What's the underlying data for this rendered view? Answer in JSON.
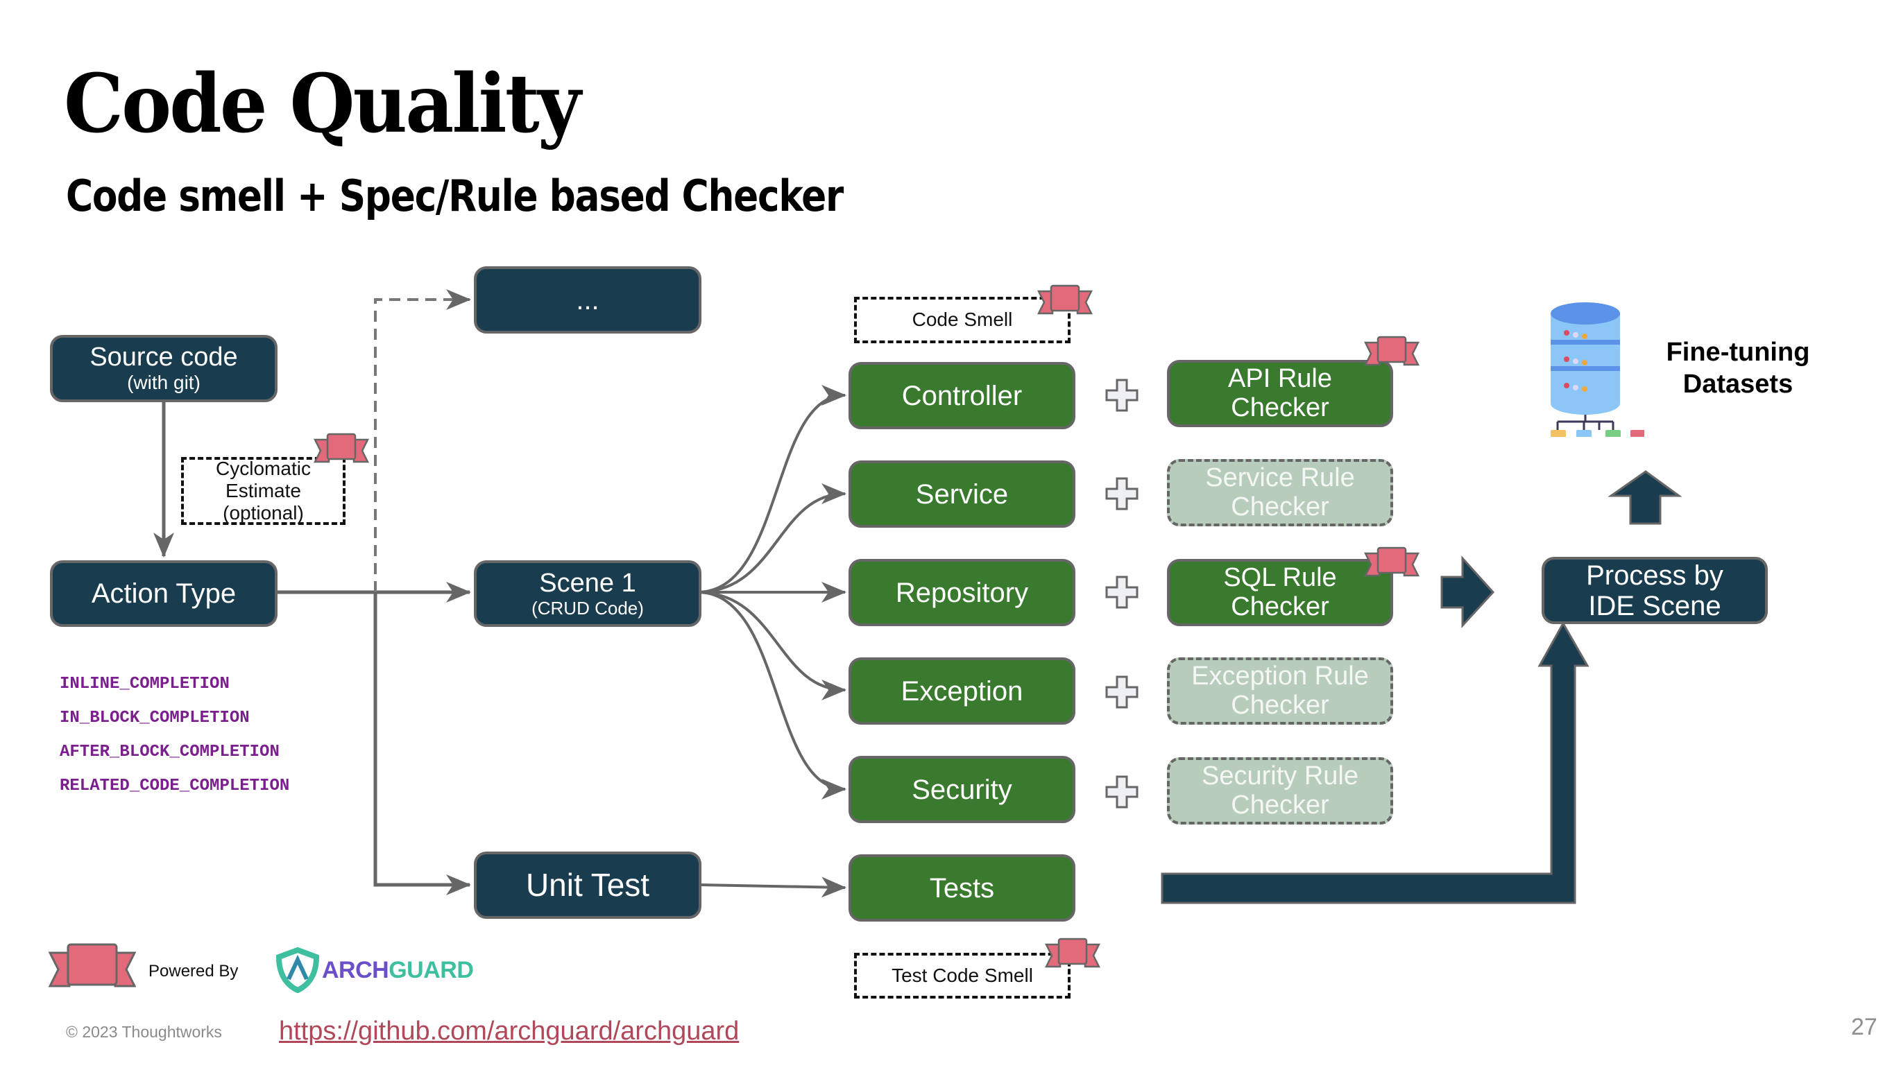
{
  "slide": {
    "title": "Code Quality",
    "subtitle": "Code smell + Spec/Rule based Checker",
    "page_number": "27"
  },
  "left": {
    "source_code": {
      "line1": "Source code",
      "line2": "(with git)"
    },
    "cyclomatic": {
      "line1": "Cyclomatic",
      "line2": "Estimate",
      "line3": "(optional)"
    },
    "action_type": "Action Type",
    "action_types": [
      "INLINE_COMPLETION",
      "IN_BLOCK_COMPLETION",
      "AFTER_BLOCK_COMPLETION",
      "RELATED_CODE_COMPLETION"
    ]
  },
  "scenes": {
    "more": "...",
    "scene1": {
      "line1": "Scene 1",
      "line2": "(CRUD Code)"
    },
    "unit_test": "Unit Test"
  },
  "code_smell_label": "Code Smell",
  "test_code_smell_label": "Test Code Smell",
  "components": [
    {
      "name": "Controller",
      "checker": [
        "API Rule",
        "Checker"
      ],
      "checker_active": true,
      "ribbon": true
    },
    {
      "name": "Service",
      "checker": [
        "Service Rule",
        "Checker"
      ],
      "checker_active": false,
      "ribbon": false
    },
    {
      "name": "Repository",
      "checker": [
        "SQL Rule",
        "Checker"
      ],
      "checker_active": true,
      "ribbon": true
    },
    {
      "name": "Exception",
      "checker": [
        "Exception Rule",
        "Checker"
      ],
      "checker_active": false,
      "ribbon": false
    },
    {
      "name": "Security",
      "checker": [
        "Security Rule",
        "Checker"
      ],
      "checker_active": false,
      "ribbon": false
    }
  ],
  "tests_label": "Tests",
  "process": {
    "line1": "Process by",
    "line2": "IDE Scene"
  },
  "output": {
    "line1": "Fine-tuning",
    "line2": "Datasets"
  },
  "footer": {
    "powered_by": "Powered By",
    "brand_part1": "ARCH",
    "brand_part2": "GUARD",
    "copyright": "© 2023 Thoughtworks",
    "link": "https://github.com/archguard/archguard"
  },
  "colors": {
    "navy": "#1a3c4f",
    "green": "#3a7a2e",
    "pale_green": "#b8ccbc",
    "ribbon": "#e26a7b",
    "arrow_gray": "#666666",
    "mono_purple": "#7b1e8e",
    "link": "#b0485a",
    "brand_purple": "#6a4fc9",
    "brand_teal": "#3dbfa0"
  }
}
